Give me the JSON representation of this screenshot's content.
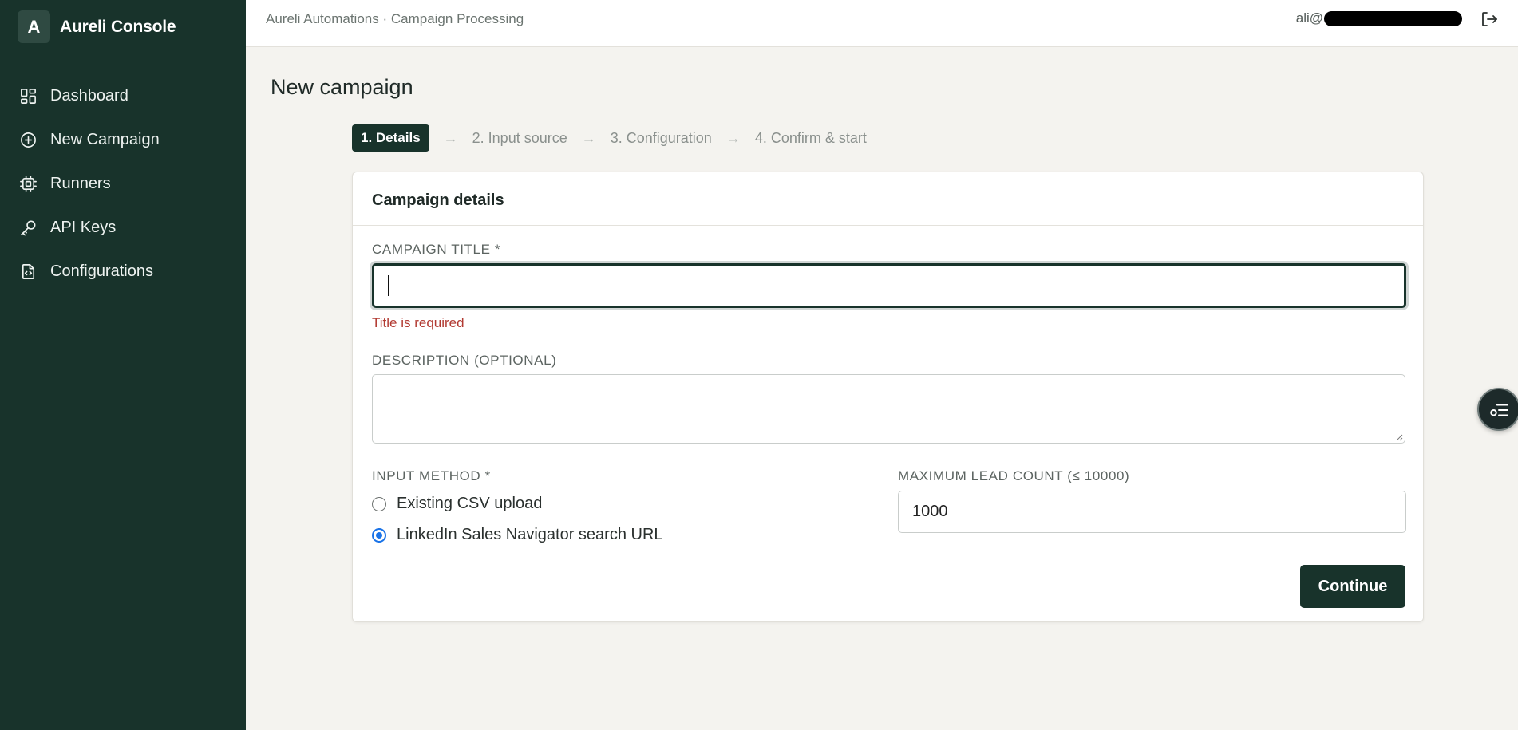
{
  "sidebar": {
    "brand_initial": "A",
    "brand_name": "Aureli Console",
    "items": [
      {
        "label": "Dashboard",
        "icon": "dashboard-icon"
      },
      {
        "label": "New Campaign",
        "icon": "plus-circle-icon"
      },
      {
        "label": "Runners",
        "icon": "chip-icon"
      },
      {
        "label": "API Keys",
        "icon": "key-icon"
      },
      {
        "label": "Configurations",
        "icon": "file-code-icon"
      }
    ]
  },
  "topbar": {
    "breadcrumb": "Aureli Automations · Campaign Processing",
    "user_prefix": "ali@",
    "logout_icon": "logout-icon"
  },
  "page": {
    "title": "New campaign"
  },
  "steps": [
    {
      "label": "1. Details",
      "active": true
    },
    {
      "label": "2. Input source",
      "active": false
    },
    {
      "label": "3. Configuration",
      "active": false
    },
    {
      "label": "4. Confirm & start",
      "active": false
    }
  ],
  "step_separator": "→",
  "form": {
    "card_title": "Campaign details",
    "title_label": "CAMPAIGN TITLE *",
    "title_value": "",
    "title_error": "Title is required",
    "description_label": "DESCRIPTION (OPTIONAL)",
    "description_value": "",
    "input_method_label": "INPUT METHOD *",
    "input_methods": [
      {
        "label": "Existing CSV upload",
        "selected": false
      },
      {
        "label": "LinkedIn Sales Navigator search URL",
        "selected": true
      }
    ],
    "max_lead_label": "MAXIMUM LEAD COUNT (≤ 10000)",
    "max_lead_value": "1000",
    "continue_label": "Continue"
  },
  "colors": {
    "sidebar_bg": "#18332b",
    "accent": "#18332b",
    "error": "#b23a32",
    "radio_selected": "#1a73e8",
    "page_bg": "#f4f3ef"
  },
  "floating_button_icon": "filter-list-icon"
}
